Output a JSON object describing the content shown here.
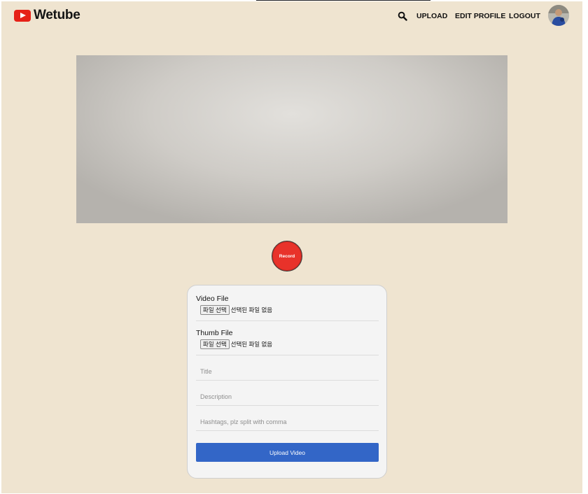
{
  "app": {
    "name": "Wetube"
  },
  "nav": {
    "upload": "UPLOAD",
    "edit_profile": "EDIT PROFILE",
    "logout": "LOGOUT"
  },
  "record": {
    "label": "Record"
  },
  "form": {
    "video_file": {
      "label": "Video File",
      "button": "파일 선택",
      "status": "선택된 파일 없음"
    },
    "thumb_file": {
      "label": "Thumb File",
      "button": "파일 선택",
      "status": "선택된 파일 없음"
    },
    "title_placeholder": "Title",
    "description_placeholder": "Description",
    "hashtags_placeholder": "Hashtags, plz split with comma",
    "submit_label": "Upload Video"
  },
  "colors": {
    "brand_red": "#e62117",
    "record_red": "#e8322a",
    "primary_blue": "#3366c7",
    "background": "#efe4d0"
  },
  "icons": {
    "logo": "youtube-play-icon",
    "search": "search-icon",
    "avatar": "user-avatar"
  }
}
